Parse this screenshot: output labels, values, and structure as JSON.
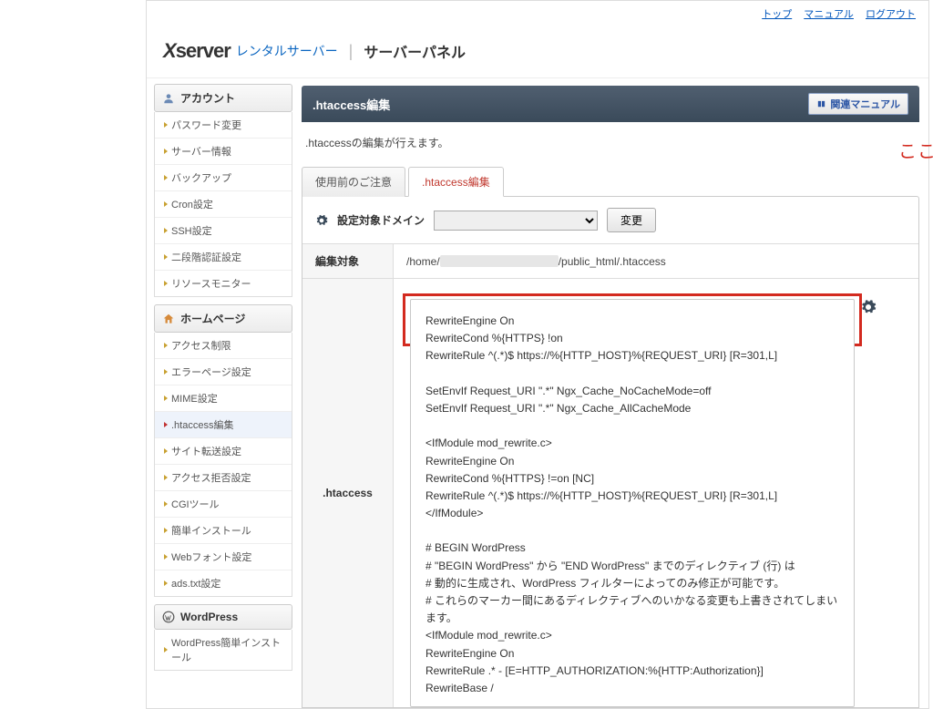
{
  "topnav": {
    "top": "トップ",
    "manual": "マニュアル",
    "logout": "ログアウト"
  },
  "logo": {
    "brand": "server",
    "sub": "レンタルサーバー",
    "panel": "サーバーパネル"
  },
  "sidebar": {
    "groups": [
      {
        "title": "アカウント",
        "items": [
          "パスワード変更",
          "サーバー情報",
          "バックアップ",
          "Cron設定",
          "SSH設定",
          "二段階認証設定",
          "リソースモニター"
        ]
      },
      {
        "title": "ホームページ",
        "items": [
          "アクセス制限",
          "エラーページ設定",
          "MIME設定",
          ".htaccess編集",
          "サイト転送設定",
          "アクセス拒否設定",
          "CGIツール",
          "簡単インストール",
          "Webフォント設定",
          "ads.txt設定"
        ],
        "activeIndex": 3
      },
      {
        "title": "WordPress",
        "items": [
          "WordPress簡単インストール"
        ]
      }
    ]
  },
  "page": {
    "title": ".htaccess編集",
    "manual_btn": "関連マニュアル",
    "desc": ".htaccessの編集が行えます。",
    "tabs": {
      "notice": "使用前のご注意",
      "edit": ".htaccess編集"
    },
    "domain": {
      "label": "設定対象ドメイン",
      "change": "変更"
    },
    "target": {
      "label": "編集対象",
      "path_prefix": "/home/",
      "path_suffix": "/public_html/.htaccess"
    },
    "editor_label": ".htaccess",
    "editor_content": "RewriteEngine On\nRewriteCond %{HTTPS} !on\nRewriteRule ^(.*)$ https://%{HTTP_HOST}%{REQUEST_URI} [R=301,L]\n\nSetEnvIf Request_URI \".*\" Ngx_Cache_NoCacheMode=off\nSetEnvIf Request_URI \".*\" Ngx_Cache_AllCacheMode\n\n<IfModule mod_rewrite.c>\nRewriteEngine On\nRewriteCond %{HTTPS} !=on [NC]\nRewriteRule ^(.*)$ https://%{HTTP_HOST}%{REQUEST_URI} [R=301,L]\n</IfModule>\n\n# BEGIN WordPress\n# \"BEGIN WordPress\" から \"END WordPress\" までのディレクティブ (行) は\n# 動的に生成され、WordPress フィルターによってのみ修正が可能です。\n# これらのマーカー間にあるディレクティブへのいかなる変更も上書きされてしまいます。\n<IfModule mod_rewrite.c>\nRewriteEngine On\nRewriteRule .* - [E=HTTP_AUTHORIZATION:%{HTTP:Authorization}]\nRewriteBase /"
  },
  "annotation": "ここに入力します。"
}
